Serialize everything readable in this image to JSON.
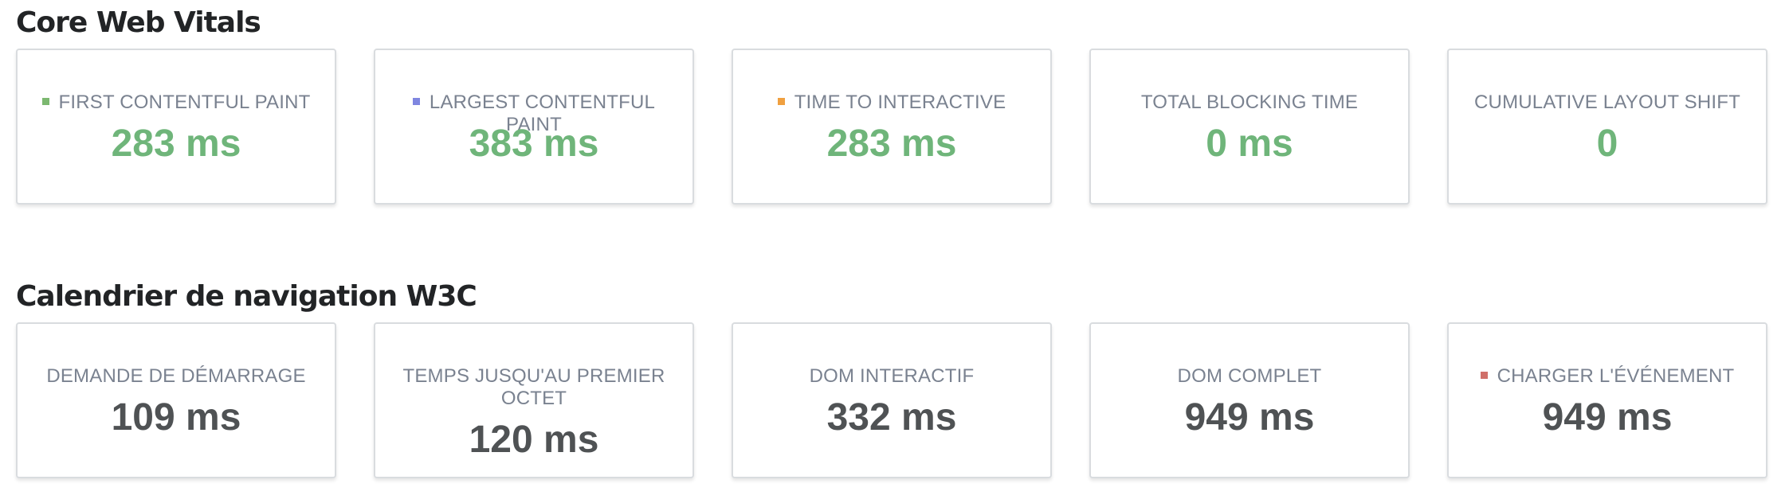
{
  "sections": [
    {
      "title": "Core Web Vitals",
      "cards": [
        {
          "label": "FIRST CONTENTFUL PAINT",
          "value": "283 ms",
          "marker_color": "#7cb870"
        },
        {
          "label": "LARGEST CONTENTFUL PAINT",
          "value": "383 ms",
          "marker_color": "#7f86e0"
        },
        {
          "label": "TIME TO INTERACTIVE",
          "value": "283 ms",
          "marker_color": "#f0a040"
        },
        {
          "label": "TOTAL BLOCKING TIME",
          "value": "0 ms"
        },
        {
          "label": "CUMULATIVE LAYOUT SHIFT",
          "value": "0"
        }
      ],
      "value_color": "#6fb57a"
    },
    {
      "title": "Calendrier de navigation W3C",
      "cards": [
        {
          "label": "DEMANDE DE DÉMARRAGE",
          "value": "109 ms"
        },
        {
          "label": "TEMPS JUSQU'AU PREMIER OCTET",
          "value": "120 ms"
        },
        {
          "label": "DOM INTERACTIF",
          "value": "332 ms"
        },
        {
          "label": "DOM COMPLET",
          "value": "949 ms"
        },
        {
          "label": "CHARGER L'ÉVÉNEMENT",
          "value": "949 ms",
          "marker_color": "#d0706a"
        }
      ],
      "value_color": "#4f5254"
    }
  ]
}
